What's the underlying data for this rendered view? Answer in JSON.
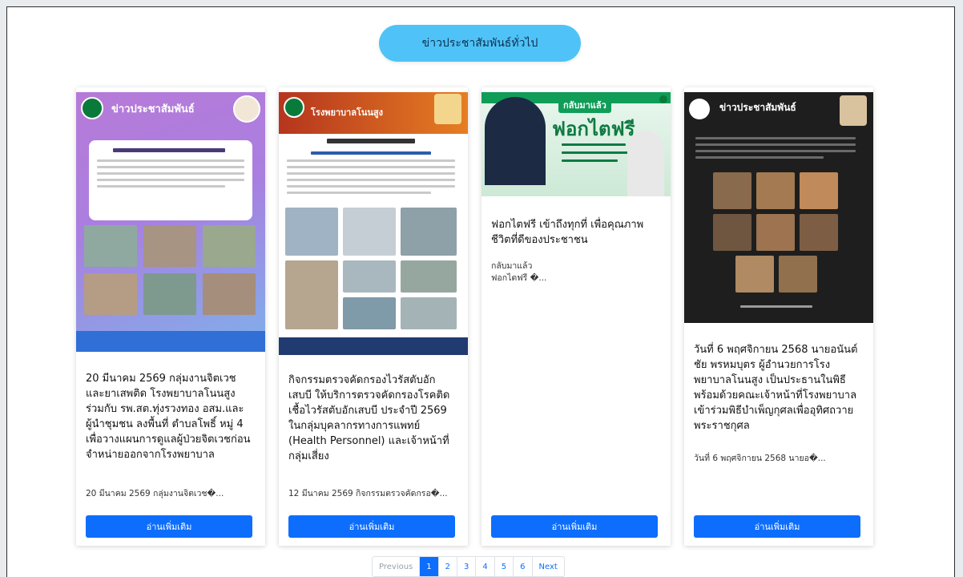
{
  "header": {
    "title": "ข่าวประชาสัมพันธ์ทั่วไป"
  },
  "cards": [
    {
      "poster_heading": "ข่าวประชาสัมพันธ์",
      "title": "20 มีนาคม 2569 กลุ่มงานจิตเวช และยาเสพติด โรงพยาบาลโนนสูง ร่วมกับ รพ.สต.ทุ่งรวงทอง อสม.และผู้นำชุมชน ลงพื้นที่ ตำบลโพธิ์ หมู่ 4 เพื่อวางแผนการดูแลผู้ป่วยจิตเวชก่อนจำหน่ายออกจากโรงพยาบาล",
      "meta": "20 มีนาคม 2569 กลุ่มงานจิตเวช�...",
      "button": "อ่านเพิ่มเติม"
    },
    {
      "poster_heading": "โรงพยาบาลโนนสูง",
      "title": "กิจกรรมตรวจคัดกรองไวรัสตับอักเสบบี ให้บริการตรวจคัดกรองโรคติดเชื้อไวรัสตับอักเสบบี ประจำปี 2569 ในกลุ่มบุคลากรทางการแพทย์ (Health Personnel) และเจ้าหน้าที่กลุ่มเสี่ยง",
      "meta": "12 มีนาคม 2569 กิจกรรมตรวจคัดกรอ�...",
      "button": "อ่านเพิ่มเติม"
    },
    {
      "poster_heading": "ฟอกไตฟรี",
      "poster_kicker": "กลับมาแล้ว",
      "title": "ฟอกไตฟรี เข้าถึงทุกที่ เพื่อคุณภาพชีวิตที่ดีของประชาชน",
      "meta": "กลับมาแล้ว\nฟอกไตฟรี �...",
      "button": "อ่านเพิ่มเติม"
    },
    {
      "poster_heading": "ข่าวประชาสัมพันธ์",
      "title": "วันที่ 6 พฤศจิกายน 2568 นายอนันต์ชัย พรหมบุตร ผู้อำนวยการโรงพยาบาลโนนสูง เป็นประธานในพิธี พร้อมด้วยคณะเจ้าหน้าที่โรงพยาบาล เข้าร่วมพิธีบำเพ็ญกุศลเพื่ออุทิศถวายพระราชกุศล",
      "meta": "วันที่ 6 พฤศจิกายน 2568 นายอ�...",
      "button": "อ่านเพิ่มเติม"
    }
  ],
  "pagination": {
    "previous": "Previous",
    "pages": [
      "1",
      "2",
      "3",
      "4",
      "5",
      "6"
    ],
    "active": "1",
    "next": "Next"
  },
  "colors": {
    "accent": "#0d6efd",
    "header_pill": "#4fc3f7",
    "card1_bg": "#b27ad6",
    "card2_bg": "#b5351e",
    "card3_bg": "#0f9d58",
    "card4_bg": "#1a1a1a"
  }
}
